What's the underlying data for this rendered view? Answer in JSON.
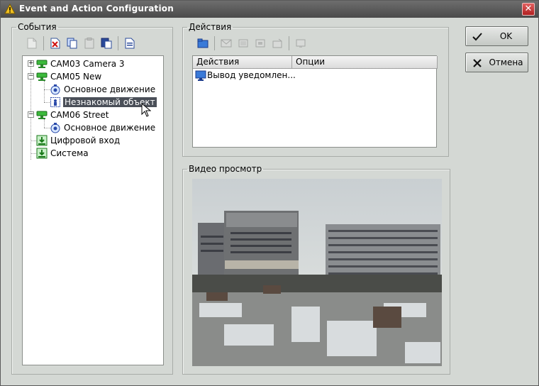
{
  "window": {
    "title": "Event and Action Configuration",
    "close_glyph": "✕"
  },
  "events": {
    "legend": "События",
    "toolbar": [
      "new-icon",
      "delete-icon",
      "copy-icon",
      "clipboard-icon",
      "paste-icon",
      "document-icon"
    ],
    "tree": [
      {
        "label": "CAM03 Camera 3",
        "icon": "camera-icon",
        "expander": "+"
      },
      {
        "label": "CAM05 New",
        "icon": "camera-icon",
        "expander": "−"
      },
      {
        "label": "Основное движение",
        "icon": "motion-icon"
      },
      {
        "label": "Незнакомый объект",
        "icon": "object-icon",
        "selected": true
      },
      {
        "label": "CAM06 Street",
        "icon": "camera-icon",
        "expander": "−"
      },
      {
        "label": "Основное движение",
        "icon": "motion-icon"
      },
      {
        "label": "Цифровой вход",
        "icon": "digital-input-icon"
      },
      {
        "label": "Система",
        "icon": "system-icon"
      }
    ]
  },
  "actions": {
    "legend": "Действия",
    "toolbar": [
      "add-action-icon",
      "email-icon",
      "record-icon",
      "ptz-icon",
      "alarm-icon",
      "notice-icon"
    ],
    "columns": [
      "Действия",
      "Опции"
    ],
    "rows": [
      {
        "action": "Вывод уведомлен...",
        "options": "",
        "icon": "monitor-icon"
      }
    ]
  },
  "preview": {
    "legend": "Видео просмотр"
  },
  "buttons": {
    "ok": "OK",
    "cancel": "Отмена"
  },
  "colors": {
    "titlebar": "#4a4a4a",
    "window_bg": "#d4d8d4",
    "selection": "#4a4f58",
    "camera_green": "#2ea02e"
  }
}
